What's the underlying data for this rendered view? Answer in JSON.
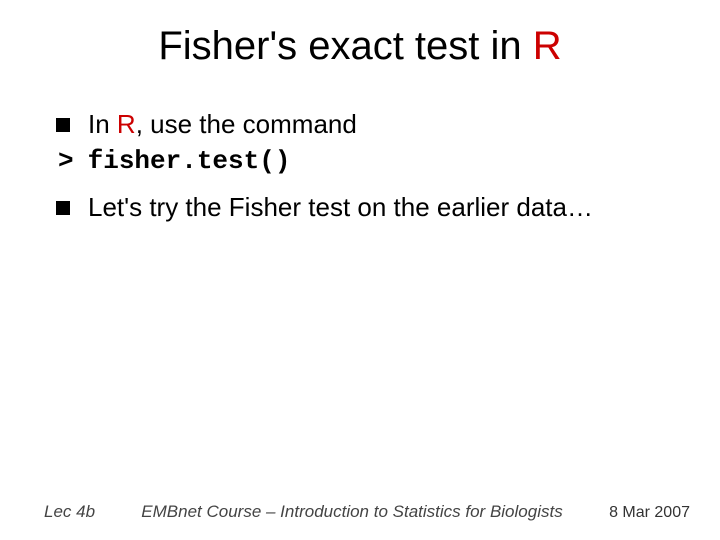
{
  "title": {
    "prefix": "Fisher's exact test in ",
    "r": "R"
  },
  "bullets": [
    {
      "text_before": "In ",
      "r": "R",
      "text_after": ", use the command"
    }
  ],
  "code": {
    "prompt": ">",
    "command": "fisher.test()"
  },
  "bullet2": "Let's try the Fisher test on the earlier data…",
  "footer": {
    "left": "Lec 4b",
    "center": "EMBnet Course – Introduction to Statistics for Biologists",
    "right": "8 Mar 2007"
  }
}
